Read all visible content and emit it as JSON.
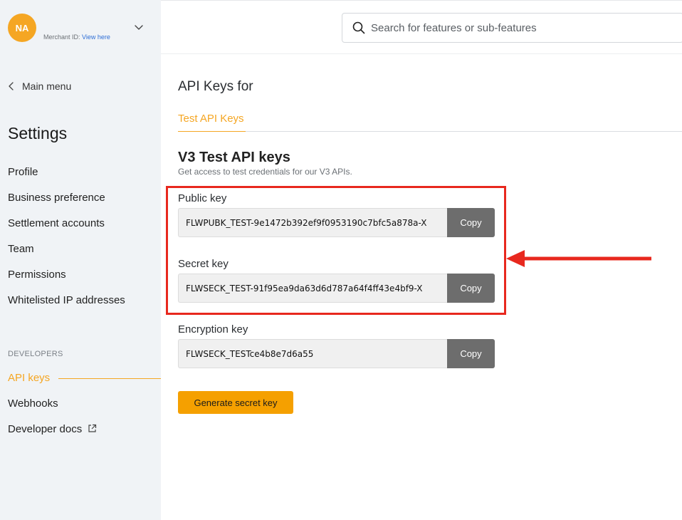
{
  "account": {
    "initials": "NA",
    "merchant_label": "Merchant ID: ",
    "view_link": "View here"
  },
  "sidebar": {
    "back_label": "Main menu",
    "title": "Settings",
    "items": [
      {
        "label": "Profile"
      },
      {
        "label": "Business preference"
      },
      {
        "label": "Settlement accounts"
      },
      {
        "label": "Team"
      },
      {
        "label": "Permissions"
      },
      {
        "label": "Whitelisted IP addresses"
      }
    ],
    "developers_heading": "DEVELOPERS",
    "developer_items": [
      {
        "label": "API keys",
        "active": true
      },
      {
        "label": "Webhooks"
      },
      {
        "label": "Developer docs"
      }
    ]
  },
  "search": {
    "placeholder": "Search for features or sub-features"
  },
  "main": {
    "page_title": "API Keys for",
    "tabs": [
      {
        "label": "Test API Keys",
        "active": true
      }
    ],
    "section_title": "V3 Test API keys",
    "section_subtitle": "Get access to test credentials for our V3 APIs.",
    "keys": [
      {
        "label": "Public key",
        "value": "FLWPUBK_TEST-9e1472b392ef9f0953190c7bfc5a878a-X",
        "copy_label": "Copy"
      },
      {
        "label": "Secret key",
        "value": "FLWSECK_TEST-91f95ea9da63d6d787a64f4ff43e4bf9-X",
        "copy_label": "Copy"
      },
      {
        "label": "Encryption key",
        "value": "FLWSECK_TESTce4b8e7d6a55",
        "copy_label": "Copy"
      }
    ],
    "generate_label": "Generate secret key"
  },
  "colors": {
    "accent": "#f5a623",
    "highlight": "#e8281e",
    "copy_button": "#6d6d6d",
    "sidebar_bg": "#f0f3f6"
  },
  "icons": [
    "chevron-down-icon",
    "chevron-left-icon",
    "search-icon",
    "external-link-icon",
    "arrow-left-icon"
  ]
}
